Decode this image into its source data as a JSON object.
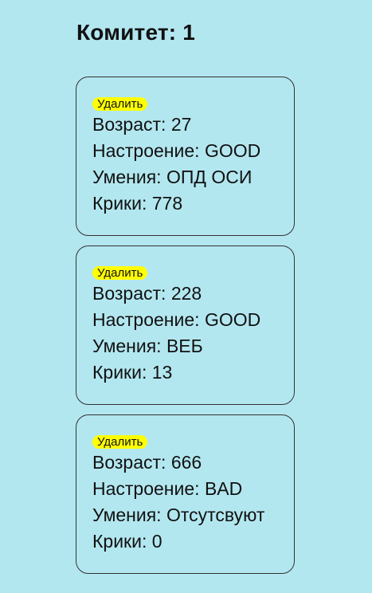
{
  "committee": {
    "title": "Комитет: 1"
  },
  "labels": {
    "age": "Возраст: ",
    "mood": "Настроение: ",
    "skills": "Умения: ",
    "screams": "Крики: "
  },
  "cards": [
    {
      "delete_label": "Удалить",
      "age": "27",
      "mood": "GOOD",
      "skills": "ОПД ОСИ",
      "screams": "778"
    },
    {
      "delete_label": "Удалить",
      "age": "228",
      "mood": "GOOD",
      "skills": "ВЕБ",
      "screams": "13"
    },
    {
      "delete_label": "Удалить",
      "age": "666",
      "mood": "BAD",
      "skills": "Отсутсвуют",
      "screams": "0"
    }
  ]
}
